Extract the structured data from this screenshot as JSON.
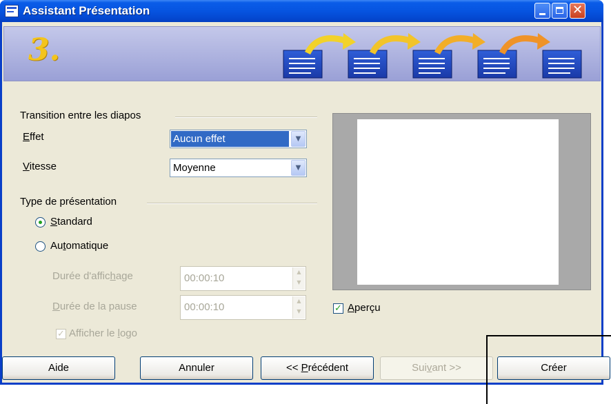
{
  "window": {
    "title": "Assistant Présentation"
  },
  "banner": {
    "step_number": "3."
  },
  "transition": {
    "section_title": "Transition entre les diapos",
    "effect": {
      "label_ul": "E",
      "label_rest": "ffet",
      "value": "Aucun effet"
    },
    "speed": {
      "label_ul": "V",
      "label_rest": "itesse",
      "value": "Moyenne"
    }
  },
  "presentation_type": {
    "section_title": "Type de présentation",
    "standard": {
      "label_ul": "S",
      "label_rest": "tandard",
      "selected": true
    },
    "automatic": {
      "label_pre": "Au",
      "label_ul": "t",
      "label_rest": "omatique",
      "selected": false
    },
    "display_duration": {
      "label_pre": "Durée d'affic",
      "label_ul": "h",
      "label_rest": "age",
      "value": "00:00:10"
    },
    "pause_duration": {
      "label_ul": "D",
      "label_rest": "urée de la pause",
      "value": "00:00:10"
    },
    "show_logo": {
      "label_pre": "Afficher le ",
      "label_ul": "l",
      "label_rest": "ogo",
      "checked": true
    }
  },
  "preview": {
    "label_ul": "A",
    "label_rest": "perçu",
    "checked": true
  },
  "buttons": {
    "help": "Aide",
    "cancel": "Annuler",
    "previous": {
      "pre": "<< ",
      "ul": "P",
      "rest": "récédent"
    },
    "next": {
      "pre": "Sui",
      "ul": "v",
      "rest": "ant >>"
    },
    "create": "Créer"
  },
  "colors": {
    "titlebar": "#0654e0",
    "dialog_bg": "#ece9d8",
    "banner_bg": "#aeb3e0",
    "step_color": "#f3c41c",
    "selection": "#316ac5"
  }
}
